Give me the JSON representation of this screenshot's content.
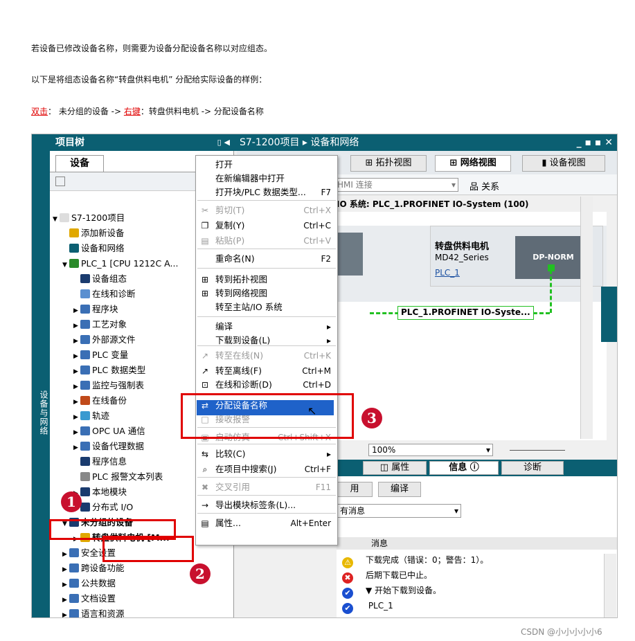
{
  "intro": {
    "line1": "若设备已修改设备名称，则需要为设备分配设备名称以对应组态。",
    "line2": "以下是将组态设备名称“转盘供料电机”  分配给实际设备的样例：",
    "line3": {
      "p1": "双击",
      "p2": "：   未分组的设备    ->   ",
      "p3": "右键",
      "p4": "：转盘供料电机    ->     分配设备名称"
    }
  },
  "left": {
    "header": "项目树",
    "side_tab": "设备与网络",
    "tab": "设备",
    "tree": [
      {
        "label": "S7-1200项目",
        "arrow": "▼",
        "icon": "#ddd"
      },
      {
        "label": "添加新设备",
        "arrow": "",
        "icon": "#e0a800"
      },
      {
        "label": "设备和网络",
        "arrow": "",
        "icon": "#0b5f72"
      },
      {
        "label": "PLC_1 [CPU 1212C A...",
        "arrow": "▼",
        "icon": "#2a8a2a"
      },
      {
        "label": "设备组态",
        "arrow": "",
        "icon": "#1a3b6e"
      },
      {
        "label": "在线和诊断",
        "arrow": "",
        "icon": "#5a8fd0"
      },
      {
        "label": "程序块",
        "arrow": "▶",
        "icon": "#3a6fb5"
      },
      {
        "label": "工艺对象",
        "arrow": "▶",
        "icon": "#3a6fb5"
      },
      {
        "label": "外部源文件",
        "arrow": "▶",
        "icon": "#3a6fb5"
      },
      {
        "label": "PLC 变量",
        "arrow": "▶",
        "icon": "#3a6fb5"
      },
      {
        "label": "PLC 数据类型",
        "arrow": "▶",
        "icon": "#3a6fb5"
      },
      {
        "label": "监控与强制表",
        "arrow": "▶",
        "icon": "#3a6fb5"
      },
      {
        "label": "在线备份",
        "arrow": "▶",
        "icon": "#c04a1a"
      },
      {
        "label": "轨迹",
        "arrow": "▶",
        "icon": "#3a9ad0"
      },
      {
        "label": "OPC UA 通信",
        "arrow": "▶",
        "icon": "#3a6fb5"
      },
      {
        "label": "设备代理数据",
        "arrow": "▶",
        "icon": "#3a6fb5"
      },
      {
        "label": "程序信息",
        "arrow": "",
        "icon": "#1a3b6e"
      },
      {
        "label": "PLC 报警文本列表",
        "arrow": "",
        "icon": "#888"
      },
      {
        "label": "本地模块",
        "arrow": "▶",
        "icon": "#1a3b6e"
      },
      {
        "label": "分布式 I/O",
        "arrow": "▶",
        "icon": "#1a3b6e"
      },
      {
        "label": "未分组的设备",
        "arrow": "▼",
        "icon": "#1a3b6e"
      },
      {
        "label": "转盘供料电机 [M...",
        "arrow": "▶",
        "icon": "#e0a800"
      },
      {
        "label": "安全设置",
        "arrow": "▶",
        "icon": "#3a6fb5"
      },
      {
        "label": "跨设备功能",
        "arrow": "▶",
        "icon": "#3a6fb5"
      },
      {
        "label": "公共数据",
        "arrow": "▶",
        "icon": "#3a6fb5"
      },
      {
        "label": "文档设置",
        "arrow": "▶",
        "icon": "#3a6fb5"
      },
      {
        "label": "语言和资源",
        "arrow": "▶",
        "icon": "#3a6fb5"
      }
    ]
  },
  "right": {
    "header": "S7-1200项目 ▸ 设备和网络",
    "tabs": [
      "拓扑视图",
      "网络视图",
      "设备视图"
    ],
    "hmi": "HMI 连接",
    "relations": "关系",
    "io_system": "IO 系统: PLC_1.PROFINET IO-System (100)",
    "device_name": "转盘供料电机",
    "device_type": "MD42_Series",
    "device_link": "PLC_1",
    "dp": "DP-NORM",
    "network": "PLC_1.PROFINET IO-Syste...",
    "zoom": "100%",
    "inspector_tabs": [
      "属性",
      "信息",
      "诊断"
    ],
    "info_tabs": [
      "用",
      "编译"
    ],
    "filter": "有消息",
    "col": "消息",
    "messages": [
      {
        "icon": "warn",
        "text": "下载完成（错误：0；警告：1）。"
      },
      {
        "icon": "err",
        "text": "后期下载已中止。"
      },
      {
        "icon": "ok",
        "text": "▼  开始下载到设备。"
      },
      {
        "icon": "ok",
        "text": "    PLC_1"
      }
    ]
  },
  "menu": [
    {
      "label": "打开",
      "sc": "",
      "dis": false,
      "ic": ""
    },
    {
      "label": "在新编辑器中打开",
      "sc": "",
      "dis": false,
      "ic": ""
    },
    {
      "label": "打开块/PLC 数据类型...",
      "sc": "F7",
      "dis": false,
      "ic": ""
    },
    {
      "label": "剪切(T)",
      "sc": "Ctrl+X",
      "dis": true,
      "ic": "✂"
    },
    {
      "label": "复制(Y)",
      "sc": "Ctrl+C",
      "dis": false,
      "ic": "❐"
    },
    {
      "label": "粘贴(P)",
      "sc": "Ctrl+V",
      "dis": true,
      "ic": "▤"
    },
    {
      "label": "重命名(N)",
      "sc": "F2",
      "dis": false,
      "ic": ""
    },
    {
      "label": "转到拓扑视图",
      "sc": "",
      "dis": false,
      "ic": "⊞"
    },
    {
      "label": "转到网络视图",
      "sc": "",
      "dis": false,
      "ic": "⊞"
    },
    {
      "label": "转至主站/IO 系统",
      "sc": "",
      "dis": false,
      "ic": ""
    },
    {
      "label": "编译",
      "sc": "▸",
      "dis": false,
      "ic": ""
    },
    {
      "label": "下载到设备(L)",
      "sc": "▸",
      "dis": false,
      "ic": ""
    },
    {
      "label": "转至在线(N)",
      "sc": "Ctrl+K",
      "dis": true,
      "ic": "↗"
    },
    {
      "label": "转至离线(F)",
      "sc": "Ctrl+M",
      "dis": false,
      "ic": "↗"
    },
    {
      "label": "在线和诊断(D)",
      "sc": "Ctrl+D",
      "dis": false,
      "ic": "⊡"
    },
    {
      "label": "分配设备名称",
      "sc": "",
      "dis": false,
      "ic": "⇄"
    },
    {
      "label": "接收报警",
      "sc": "",
      "dis": true,
      "ic": "□"
    },
    {
      "label": "启动仿真",
      "sc": "Ctrl+Shift+X",
      "dis": true,
      "ic": "▣"
    },
    {
      "label": "比较(C)",
      "sc": "▸",
      "dis": false,
      "ic": "⇆"
    },
    {
      "label": "在项目中搜索(J)",
      "sc": "Ctrl+F",
      "dis": false,
      "ic": "⌕"
    },
    {
      "label": "交叉引用",
      "sc": "F11",
      "dis": true,
      "ic": "✖"
    },
    {
      "label": "导出模块标签条(L)...",
      "sc": "",
      "dis": false,
      "ic": "→"
    },
    {
      "label": "属性...",
      "sc": "Alt+Enter",
      "dis": false,
      "ic": "▤"
    }
  ],
  "marks": [
    "1",
    "2",
    "3"
  ],
  "watermark": "CSDN @小小小小小6"
}
